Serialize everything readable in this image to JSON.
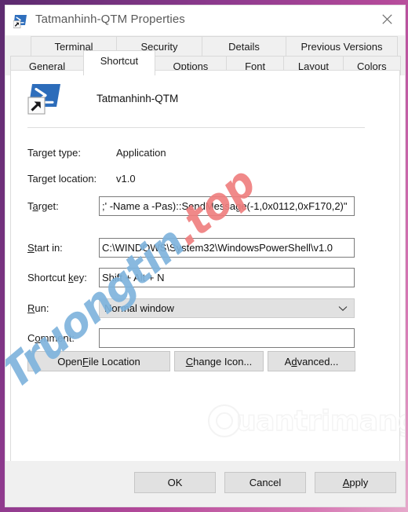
{
  "window": {
    "title": "Tatmanhinh-QTM Properties",
    "icon": "powershell-shortcut-icon",
    "close_label": "close-icon"
  },
  "tabs": {
    "row1": [
      {
        "label": "Terminal",
        "active": false
      },
      {
        "label": "Security",
        "active": false
      },
      {
        "label": "Details",
        "active": false
      },
      {
        "label": "Previous Versions",
        "active": false
      }
    ],
    "row2": [
      {
        "label": "General",
        "active": false
      },
      {
        "label": "Shortcut",
        "active": true
      },
      {
        "label": "Options",
        "active": false
      },
      {
        "label": "Font",
        "active": false
      },
      {
        "label": "Layout",
        "active": false
      },
      {
        "label": "Colors",
        "active": false
      }
    ]
  },
  "shortcut_page": {
    "app_name": "Tatmanhinh-QTM",
    "fields": {
      "target_type_label": "Target type:",
      "target_type_value": "Application",
      "target_location_label": "Target location:",
      "target_location_value": "v1.0",
      "target_label_pre": "T",
      "target_label_accel": "a",
      "target_label_post": "rget:",
      "target_value": ";' -Name a -Pas)::SendMessage(-1,0x0112,0xF170,2)\"",
      "start_in_accel": "S",
      "start_in_post": "tart in:",
      "start_in_value": "C:\\WINDOWS\\System32\\WindowsPowerShell\\v1.0",
      "shortcut_key_pre": "Shortcut ",
      "shortcut_key_accel": "k",
      "shortcut_key_post": "ey:",
      "shortcut_key_value": "Shift + Alt + N",
      "run_accel": "R",
      "run_post": "un:",
      "run_value": "Normal window",
      "comment_pre": "C",
      "comment_accel": "o",
      "comment_post": "mment:",
      "comment_value": "",
      "comment_placeholder": ""
    },
    "buttons": {
      "open_file_location_pre": "Open ",
      "open_file_location_accel": "F",
      "open_file_location_post": "ile Location",
      "change_icon_accel": "C",
      "change_icon_post": "hange Icon...",
      "advanced_pre": "A",
      "advanced_accel": "d",
      "advanced_post": "vanced..."
    }
  },
  "command_bar": {
    "ok": "OK",
    "cancel": "Cancel",
    "apply_pre": "",
    "apply_accel": "A",
    "apply_post": "pply"
  },
  "watermarks": {
    "primary_a": "Truongtin",
    "primary_b": ".top",
    "secondary": "uantrimang",
    "primary_color_a": "#7fb4dd",
    "primary_color_b": "#ef7f7f",
    "secondary_color": "#f4f4f4"
  },
  "theme": {
    "accent_desktop": "#8e3a8e",
    "dialog_bg": "#ffffff",
    "chrome_bg": "#f0f0f0",
    "button_bg": "#e1e1e1",
    "field_border": "#7b7b7b",
    "icon_blue": "#2b6fc4"
  }
}
